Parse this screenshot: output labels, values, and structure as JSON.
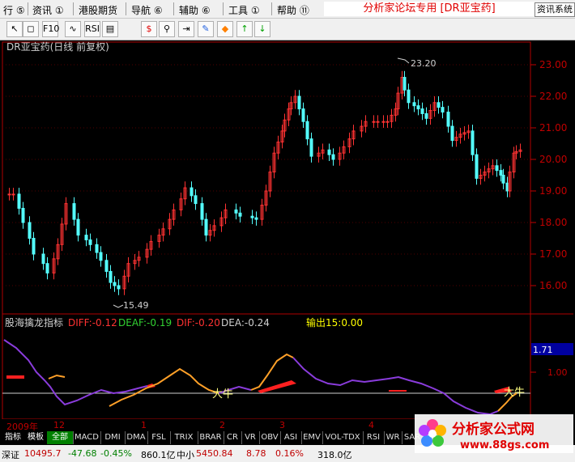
{
  "menu": {
    "items": [
      {
        "label": "行 ⑤"
      },
      {
        "label": "资讯 ①"
      },
      {
        "label": "港股期货"
      },
      {
        "label": "导航 ⑥"
      },
      {
        "label": "辅助 ⑥"
      },
      {
        "label": "工具 ①"
      },
      {
        "label": "帮助 ⑪"
      }
    ],
    "brand_text": "分析家论坛专用 [DR亚宝药]",
    "brand_button": "资讯系统"
  },
  "toolbar": {
    "icons": [
      "pointer-icon",
      "zoom-icon",
      "f10-icon",
      "chart-icon",
      "list-icon",
      "table-icon",
      "dollar-icon",
      "link-icon",
      "export-icon",
      "pencil-icon",
      "diamond-icon",
      "up-arrow-icon",
      "down-arrow-icon"
    ],
    "labels": {
      "pointer-icon": "↖",
      "zoom-icon": "◻",
      "f10-icon": "F10",
      "chart-icon": "∿",
      "list-icon": "RSI",
      "table-icon": "▤",
      "dollar-icon": "$",
      "link-icon": "⚲",
      "export-icon": "⇥",
      "pencil-icon": "✎",
      "diamond-icon": "◆",
      "up-arrow-icon": "↑",
      "down-arrow-icon": "↓"
    }
  },
  "main_chart": {
    "title": "DR亚宝药(日线 前复权)",
    "y_ticks": [
      "23.00",
      "22.00",
      "21.00",
      "20.00",
      "19.00",
      "18.00",
      "17.00",
      "16.00"
    ],
    "high_label": "23.20",
    "low_label": "15.49"
  },
  "indicator": {
    "name": "股海擒龙指标",
    "diff": "DIFF:-0.12",
    "deaf": "DEAF:-0.19",
    "dif": "DIF:-0.20",
    "dea": "DEA:-0.24",
    "output": "输出15:0.00",
    "y_label": "1.00",
    "highlight": "1.71",
    "bull_label_1": "大牛",
    "bull_label_2": "大牛"
  },
  "date_axis": [
    "2009年",
    "12",
    "1",
    "2",
    "3",
    "4"
  ],
  "tabs": [
    "指标",
    "模板",
    "全部",
    "MACD",
    "DMI",
    "DMA",
    "FSL",
    "TRIX",
    "BRAR",
    "CR",
    "VR",
    "OBV",
    "ASI",
    "EMV",
    "VOL-TDX",
    "RSI",
    "WR",
    "SAR"
  ],
  "active_tab": "全部",
  "status": {
    "index_name": "深证",
    "index_value": "10495.7",
    "change": "-47.68",
    "pct": "-0.45%",
    "volume": "860.1亿",
    "sme_label": "中小",
    "sme_value": "5450.84",
    "sme_change": "8.78",
    "sme_pct": "0.16%",
    "sme_volume": "318.0亿"
  },
  "watermark": {
    "brand": "分析家公式网",
    "url": "www.88gs.com"
  },
  "colors": {
    "up": "#ff3232",
    "down": "#54ffff",
    "axis": "#c00000",
    "purple": "#8a3cdc",
    "orange": "#ffa028"
  }
}
